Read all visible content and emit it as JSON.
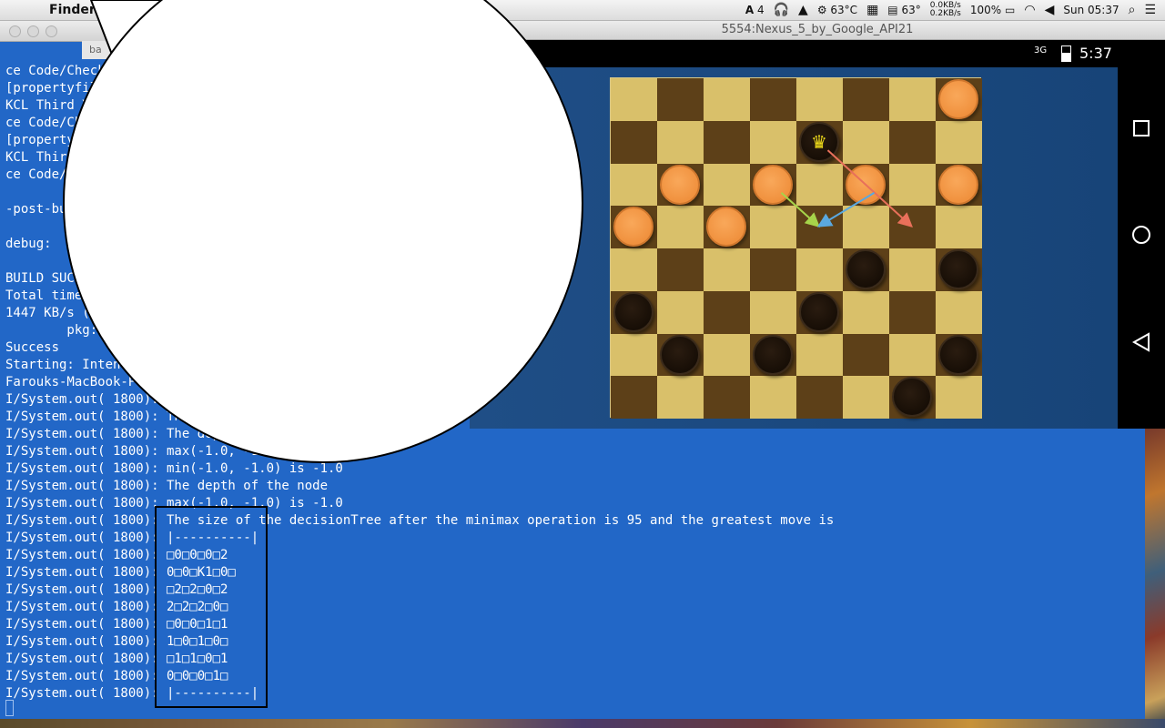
{
  "menubar": {
    "app_name": "Finder",
    "status": {
      "adobe": "4",
      "cpu_temp": "63°C",
      "gpu_temp": "63°",
      "net_up": "0.0KB/s",
      "net_down": "0.2KB/s",
      "battery": "100%",
      "clock": "Sun 05:37"
    }
  },
  "terminal": {
    "tab_label": "ba",
    "lines": [
      "ce Code/Checkers/...",
      "[propertyfile] ...",
      "KCL Third Year ...",
      "ce Code/Checkers/...",
      "[propertyfile] ...",
      "KCL Third Year ...",
      "ce Code/Checkers/...",
      "",
      "-post-build:",
      "",
      "debug:",
      "",
      "BUILD SUCCESSFUL",
      "Total time: ...",
      "1447 KB/s (...)",
      "        pkg: ...",
      "Success",
      "Starting: Intent { ... }",
      "Farouks-MacBook-Pro:...",
      "I/System.out( 1800): ...",
      "I/System.out( 1800): The depth of the node",
      "I/System.out( 1800): The depth of the node",
      "I/System.out( 1800): max(-1.0, -1.0) is -1.0",
      "I/System.out( 1800): min(-1.0, -1.0) is -1.0",
      "I/System.out( 1800): The depth of the node",
      "I/System.out( 1800): max(-1.0, -1.0) is -1.0",
      "I/System.out( 1800): The size of the decisionTree after the minimax operation is 95 and the greatest move is",
      "I/System.out( 1800): |----------|",
      "I/System.out( 1800): □0□0□0□2",
      "I/System.out( 1800): 0□0□K1□0□",
      "I/System.out( 1800): □2□2□0□2",
      "I/System.out( 1800): 2□2□2□0□",
      "I/System.out( 1800): □0□0□1□1",
      "I/System.out( 1800): 1□0□1□0□",
      "I/System.out( 1800): □1□1□0□1",
      "I/System.out( 1800): 0□0□0□1□",
      "I/System.out( 1800): |----------|"
    ]
  },
  "emulator": {
    "title": "5554:Nexus_5_by_Google_API21",
    "network": "3G",
    "time": "5:37"
  },
  "board": {
    "squares": 8,
    "light_color": "#d9c06a",
    "dark_color": "#5d4018",
    "pieces": [
      {
        "color": "orange",
        "row": 0,
        "col": 7,
        "king": false
      },
      {
        "color": "black",
        "row": 1,
        "col": 4,
        "king": true
      },
      {
        "color": "orange",
        "row": 2,
        "col": 1,
        "king": false
      },
      {
        "color": "orange",
        "row": 2,
        "col": 3,
        "king": false
      },
      {
        "color": "orange",
        "row": 2,
        "col": 5,
        "king": false
      },
      {
        "color": "orange",
        "row": 2,
        "col": 7,
        "king": false
      },
      {
        "color": "orange",
        "row": 3,
        "col": 0,
        "king": false
      },
      {
        "color": "orange",
        "row": 3,
        "col": 2,
        "king": false
      },
      {
        "color": "black",
        "row": 4,
        "col": 5,
        "king": false
      },
      {
        "color": "black",
        "row": 4,
        "col": 7,
        "king": false
      },
      {
        "color": "black",
        "row": 5,
        "col": 0,
        "king": false
      },
      {
        "color": "black",
        "row": 5,
        "col": 4,
        "king": false
      },
      {
        "color": "black",
        "row": 6,
        "col": 1,
        "king": false
      },
      {
        "color": "black",
        "row": 6,
        "col": 3,
        "king": false
      },
      {
        "color": "black",
        "row": 6,
        "col": 7,
        "king": false
      },
      {
        "color": "black",
        "row": 7,
        "col": 6,
        "king": false
      }
    ],
    "move_arrows": [
      {
        "from": [
          1,
          4
        ],
        "to": [
          3,
          6
        ],
        "color": "#e8705a"
      },
      {
        "from": [
          2,
          3
        ],
        "to": [
          3,
          4
        ],
        "color": "#a6d44a"
      },
      {
        "from": [
          2,
          5
        ],
        "to": [
          3,
          4
        ],
        "color": "#5aa8e0"
      }
    ]
  }
}
